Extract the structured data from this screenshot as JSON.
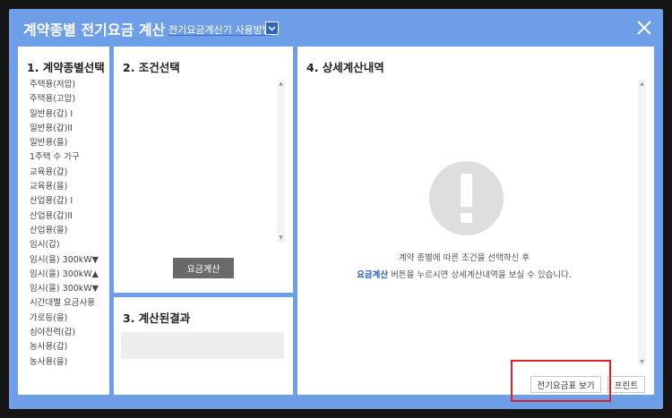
{
  "window": {
    "title": "계약종별 전기요금 계산",
    "help_link": "전기요금계산기 사용방법"
  },
  "panel1": {
    "title": "1. 계약종별선택",
    "items": [
      "주택용(저압)",
      "주택용(고압)",
      "일반용(갑) I",
      "일반용(갑)II",
      "일반용(을)",
      "1주택 수 가구",
      "교육용(갑)",
      "교육용(을)",
      "산업용(갑) I",
      "산업용(갑)II",
      "산업용(을)",
      "임시(갑)",
      "임시(을) 300kW▼",
      "임시(을) 300kW▲",
      "임시(을) 300kW▼",
      "시간대별 요금사용",
      "가로등(을)",
      "심야전력(갑)",
      "농사용(갑)",
      "농사용(을)"
    ]
  },
  "panel2": {
    "title": "2. 조건선택",
    "calc_button": "요금계산"
  },
  "panel3": {
    "title": "3. 계산된결과"
  },
  "panel4": {
    "title": "4. 상세계산내역",
    "message_line1": "계약 종별에 따른 조건을 선택하신 후",
    "message_highlight": "요금계산",
    "message_line2_rest": " 버튼을 누르시면 상세계산내역을 보실 수 있습니다.",
    "view_table_button": "전기요금표 보기",
    "print_button": "프린트"
  },
  "colors": {
    "frame": "#6f9ee8",
    "highlight_box": "#d9232b",
    "accent_text": "#2a5db0"
  },
  "icons": [
    "chevron-down-icon",
    "close-icon",
    "exclamation-icon",
    "scroll-up-icon",
    "scroll-down-icon"
  ]
}
